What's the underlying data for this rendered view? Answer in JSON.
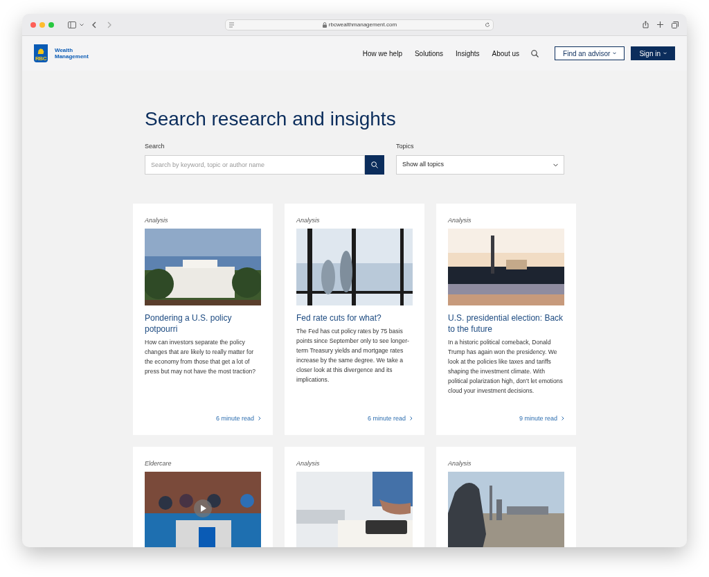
{
  "browser": {
    "address": "rbcwealthmanagement.com"
  },
  "header": {
    "logo": {
      "mark": "RBC",
      "line_1": "Wealth",
      "line_2": "Management"
    },
    "nav": [
      {
        "label": "How we help"
      },
      {
        "label": "Solutions"
      },
      {
        "label": "Insights"
      },
      {
        "label": "About us"
      }
    ],
    "buttons": [
      {
        "label": "Find an advisor",
        "kind": "outline"
      },
      {
        "label": "Sign in",
        "kind": "solid"
      }
    ]
  },
  "page_title": "Search research and insights",
  "search": {
    "label": "Search",
    "placeholder": "Search by keyword, topic or author name"
  },
  "topics": {
    "label": "Topics",
    "value": "Show all topics"
  },
  "cards": [
    {
      "category": "Analysis",
      "kind": "article",
      "title": "Pondering a U.S. policy potpourri",
      "summary": "How can investors separate the policy changes that are likely to really matter for the economy from those that get a lot of press but may not have the most traction?",
      "read_time": "6 minute read"
    },
    {
      "category": "Analysis",
      "kind": "article",
      "title": "Fed rate cuts for what?",
      "summary": "The Fed has cut policy rates by 75 basis points since September only to see longer-term Treasury yields and mortgage rates increase by the same degree. We take a closer look at this divergence and its implications.",
      "read_time": "6 minute read"
    },
    {
      "category": "Analysis",
      "kind": "article",
      "title": "U.S. presidential election: Back to the future",
      "summary": "In a historic political comeback, Donald Trump has again won the presidency. We look at the policies like taxes and tariffs shaping the investment climate. With political polarization high, don’t let emotions cloud your investment decisions.",
      "read_time": "9 minute read"
    },
    {
      "category": "Eldercare",
      "kind": "video"
    },
    {
      "category": "Analysis",
      "kind": "article"
    },
    {
      "category": "Analysis",
      "kind": "article"
    }
  ]
}
